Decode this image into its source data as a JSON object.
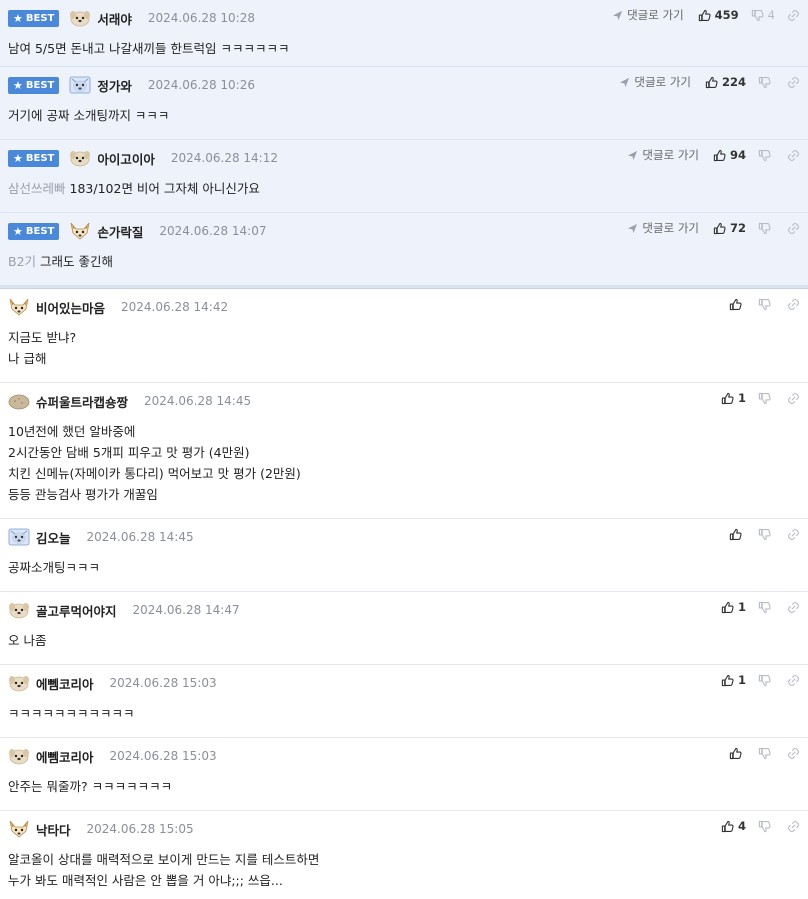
{
  "labels": {
    "best": "BEST",
    "goto": "댓글로 가기"
  },
  "colors": {
    "best_bg": "#eef3fb",
    "best_badge": "#4a88d9",
    "date": "#8a8f99"
  },
  "comments": [
    {
      "best": true,
      "avatar": "dog-icon-beige",
      "nick": "서래야",
      "date": "2024.06.28 10:28",
      "mention": "",
      "text": "남여 5/5면 돈내고 나갈새끼들 한트럭임 ㅋㅋㅋㅋㅋㅋ",
      "up": "459",
      "down": "4"
    },
    {
      "best": true,
      "avatar": "bear-icon-blue",
      "nick": "정가와",
      "date": "2024.06.28 10:26",
      "mention": "",
      "text": "거기에 공짜 소개팅까지 ㅋㅋㅋ",
      "up": "224",
      "down": ""
    },
    {
      "best": true,
      "avatar": "dog-icon-beige",
      "nick": "아이고이아",
      "date": "2024.06.28 14:12",
      "mention": "삼선쓰레빠",
      "text": "183/102면 비어 그자체 아니신가요",
      "up": "94",
      "down": ""
    },
    {
      "best": true,
      "avatar": "fox-icon",
      "nick": "손가락질",
      "date": "2024.06.28 14:07",
      "mention": "B2기",
      "text": "그래도 좋긴해",
      "up": "72",
      "down": ""
    },
    {
      "best": false,
      "avatar": "fox-icon",
      "nick": "비어있는마음",
      "date": "2024.06.28 14:42",
      "mention": "",
      "text": "지금도 받냐?\n나 급해",
      "up": "",
      "down": ""
    },
    {
      "best": false,
      "avatar": "potato-icon",
      "nick": "슈퍼울트라캡숑짱",
      "date": "2024.06.28 14:45",
      "mention": "",
      "text": "10년전에 했던 알바중에\n2시간동안 담배 5개피 피우고 맛 평가 (4만원)\n치킨 신메뉴(자메이카 통다리) 먹어보고 맛 평가 (2만원)\n등등 관능검사 평가가 개꿀임",
      "up": "1",
      "down": ""
    },
    {
      "best": false,
      "avatar": "bear-icon-blue",
      "nick": "김오늘",
      "date": "2024.06.28 14:45",
      "mention": "",
      "text": "공짜소개팅ㅋㅋㅋ",
      "up": "",
      "down": ""
    },
    {
      "best": false,
      "avatar": "dog-icon-beige",
      "nick": "골고루먹어야지",
      "date": "2024.06.28 14:47",
      "mention": "",
      "text": "오 나좀",
      "up": "1",
      "down": ""
    },
    {
      "best": false,
      "avatar": "dog-icon-beige",
      "nick": "에뻼코리아",
      "date": "2024.06.28 15:03",
      "mention": "",
      "text": "ㅋㅋㅋㅋㅋㅋㅋㅋㅋㅋㅋ",
      "up": "1",
      "down": ""
    },
    {
      "best": false,
      "avatar": "dog-icon-beige",
      "nick": "에뻼코리아",
      "date": "2024.06.28 15:03",
      "mention": "",
      "text": "안주는 뭐줄까? ㅋㅋㅋㅋㅋㅋㅋ",
      "up": "",
      "down": ""
    },
    {
      "best": false,
      "avatar": "fox-icon",
      "nick": "낙타다",
      "date": "2024.06.28 15:05",
      "mention": "",
      "text": "알코올이 상대를 매력적으로 보이게 만드는 지를 테스트하면\n누가 봐도 매력적인 사람은 안 뽑을 거 아냐;;; 쓰읍...",
      "up": "4",
      "down": ""
    }
  ]
}
